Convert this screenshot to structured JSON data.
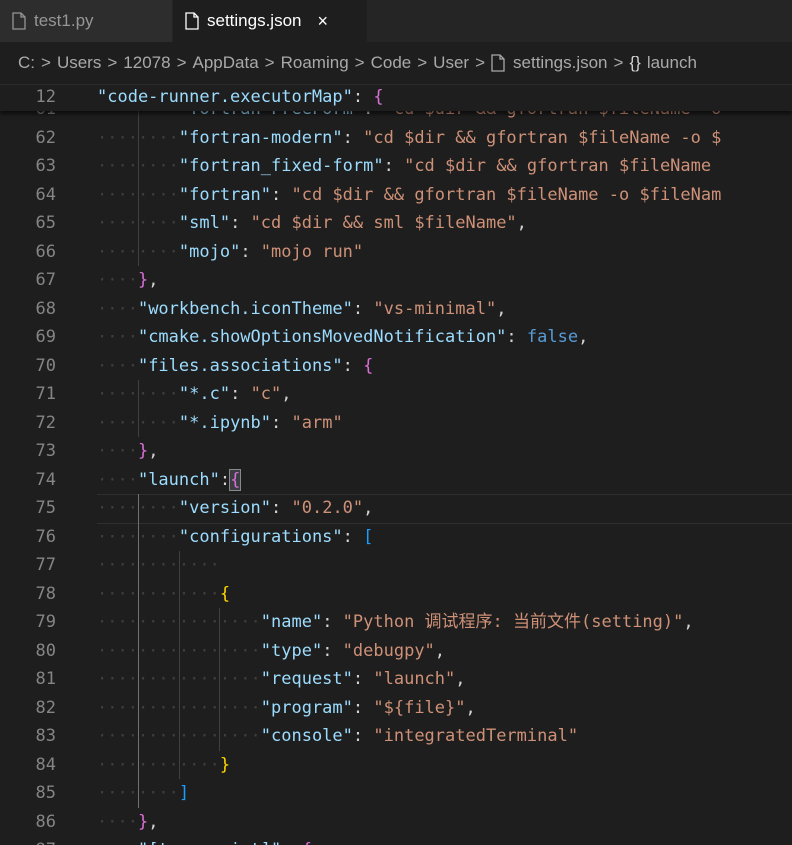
{
  "tabs": [
    {
      "label": "test1.py",
      "icon": "file-icon",
      "active": false
    },
    {
      "label": "settings.json",
      "icon": "file-icon",
      "active": true,
      "close": "×"
    }
  ],
  "breadcrumb": {
    "items": [
      "C:",
      "Users",
      "12078",
      "AppData",
      "Roaming",
      "Code",
      "User",
      "settings.json",
      "launch"
    ],
    "separator": ">",
    "last_icon": "{}"
  },
  "sticky": {
    "line_number": "12",
    "key": "\"code-runner.executorMap\"",
    "colon": ": ",
    "brace": "{"
  },
  "lines": [
    {
      "n": "61",
      "ws": "········",
      "parts": [
        [
          "key",
          "\"fortran-FreeForm\""
        ],
        [
          "punc",
          ": "
        ],
        [
          "str",
          "\"cd $dir && gfortran $fileName -o"
        ]
      ]
    },
    {
      "n": "62",
      "ws": "········",
      "parts": [
        [
          "key",
          "\"fortran-modern\""
        ],
        [
          "punc",
          ": "
        ],
        [
          "str",
          "\"cd $dir && gfortran $fileName -o $"
        ]
      ]
    },
    {
      "n": "63",
      "ws": "········",
      "parts": [
        [
          "key",
          "\"fortran_fixed-form\""
        ],
        [
          "punc",
          ": "
        ],
        [
          "str",
          "\"cd $dir && gfortran $fileName"
        ]
      ]
    },
    {
      "n": "64",
      "ws": "········",
      "parts": [
        [
          "key",
          "\"fortran\""
        ],
        [
          "punc",
          ": "
        ],
        [
          "str",
          "\"cd $dir && gfortran $fileName -o $fileNam"
        ]
      ]
    },
    {
      "n": "65",
      "ws": "········",
      "parts": [
        [
          "key",
          "\"sml\""
        ],
        [
          "punc",
          ": "
        ],
        [
          "str",
          "\"cd $dir && sml $fileName\""
        ],
        [
          "punc",
          ","
        ]
      ]
    },
    {
      "n": "66",
      "ws": "········",
      "parts": [
        [
          "key",
          "\"mojo\""
        ],
        [
          "punc",
          ": "
        ],
        [
          "str",
          "\"mojo run\""
        ]
      ]
    },
    {
      "n": "67",
      "ws": "····",
      "parts": [
        [
          "b2",
          "}"
        ],
        [
          "punc",
          ","
        ]
      ]
    },
    {
      "n": "68",
      "ws": "····",
      "parts": [
        [
          "key",
          "\"workbench.iconTheme\""
        ],
        [
          "punc",
          ": "
        ],
        [
          "str",
          "\"vs-minimal\""
        ],
        [
          "punc",
          ","
        ]
      ]
    },
    {
      "n": "69",
      "ws": "····",
      "parts": [
        [
          "key",
          "\"cmake.showOptionsMovedNotification\""
        ],
        [
          "punc",
          ": "
        ],
        [
          "bool",
          "false"
        ],
        [
          "punc",
          ","
        ]
      ]
    },
    {
      "n": "70",
      "ws": "····",
      "parts": [
        [
          "key",
          "\"files.associations\""
        ],
        [
          "punc",
          ": "
        ],
        [
          "b2",
          "{"
        ]
      ]
    },
    {
      "n": "71",
      "ws": "········",
      "parts": [
        [
          "key",
          "\"*.c\""
        ],
        [
          "punc",
          ": "
        ],
        [
          "str",
          "\"c\""
        ],
        [
          "punc",
          ","
        ]
      ]
    },
    {
      "n": "72",
      "ws": "········",
      "parts": [
        [
          "key",
          "\"*.ipynb\""
        ],
        [
          "punc",
          ": "
        ],
        [
          "str",
          "\"arm\""
        ]
      ]
    },
    {
      "n": "73",
      "ws": "····",
      "parts": [
        [
          "b2",
          "}"
        ],
        [
          "punc",
          ","
        ]
      ]
    },
    {
      "n": "74",
      "ws": "····",
      "parts": [
        [
          "key",
          "\"launch\""
        ],
        [
          "punc",
          ":"
        ],
        [
          "b2",
          "{"
        ]
      ]
    },
    {
      "n": "75",
      "ws": "········",
      "parts": [
        [
          "key",
          "\"version\""
        ],
        [
          "punc",
          ": "
        ],
        [
          "str",
          "\"0.2.0\""
        ],
        [
          "punc",
          ","
        ]
      ]
    },
    {
      "n": "76",
      "ws": "········",
      "parts": [
        [
          "key",
          "\"configurations\""
        ],
        [
          "punc",
          ": "
        ],
        [
          "b3",
          "["
        ]
      ]
    },
    {
      "n": "77",
      "ws": "············",
      "parts": []
    },
    {
      "n": "78",
      "ws": "············",
      "parts": [
        [
          "b1",
          "{"
        ]
      ]
    },
    {
      "n": "79",
      "ws": "················",
      "parts": [
        [
          "key",
          "\"name\""
        ],
        [
          "punc",
          ": "
        ],
        [
          "str",
          "\"Python 调试程序: 当前文件(setting)\""
        ],
        [
          "punc",
          ","
        ]
      ]
    },
    {
      "n": "80",
      "ws": "················",
      "parts": [
        [
          "key",
          "\"type\""
        ],
        [
          "punc",
          ": "
        ],
        [
          "str",
          "\"debugpy\""
        ],
        [
          "punc",
          ","
        ]
      ]
    },
    {
      "n": "81",
      "ws": "················",
      "parts": [
        [
          "key",
          "\"request\""
        ],
        [
          "punc",
          ": "
        ],
        [
          "str",
          "\"launch\""
        ],
        [
          "punc",
          ","
        ]
      ]
    },
    {
      "n": "82",
      "ws": "················",
      "parts": [
        [
          "key",
          "\"program\""
        ],
        [
          "punc",
          ": "
        ],
        [
          "str",
          "\"${file}\""
        ],
        [
          "punc",
          ","
        ]
      ]
    },
    {
      "n": "83",
      "ws": "················",
      "parts": [
        [
          "key",
          "\"console\""
        ],
        [
          "punc",
          ": "
        ],
        [
          "str",
          "\"integratedTerminal\""
        ]
      ]
    },
    {
      "n": "84",
      "ws": "············",
      "parts": [
        [
          "b1",
          "}"
        ]
      ]
    },
    {
      "n": "85",
      "ws": "········",
      "parts": [
        [
          "b3",
          "]"
        ]
      ]
    },
    {
      "n": "86",
      "ws": "····",
      "parts": [
        [
          "b2",
          "}"
        ],
        [
          "punc",
          ","
        ]
      ]
    },
    {
      "n": "87",
      "ws": "····",
      "parts": [
        [
          "key",
          "\"[typescript]\""
        ],
        [
          "punc",
          ": "
        ],
        [
          "b2",
          "{"
        ]
      ]
    }
  ]
}
